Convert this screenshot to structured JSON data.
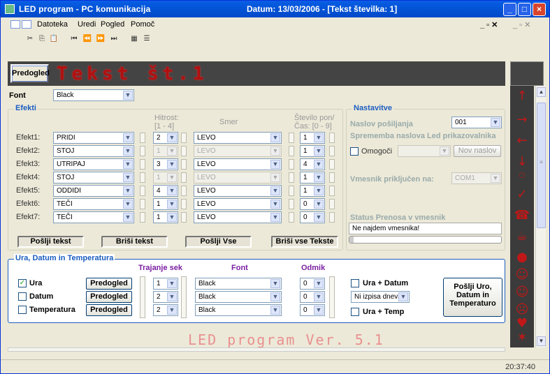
{
  "titlebar": {
    "title": "LED program - PC komunikacija",
    "date": "Datum: 13/03/2006 - [Tekst številka:  1]"
  },
  "menu": [
    "Datoteka",
    "Uredi",
    "Pogled",
    "Pomoč"
  ],
  "header": {
    "preview_button": "Predogled",
    "led_text": "Tekst št.1"
  },
  "font": {
    "label": "Font",
    "value": "Black"
  },
  "effects": {
    "legend": "Efekti",
    "speed_header": "Hitrost:",
    "speed_range": "[1 - 4]",
    "direction_header": "Smer",
    "repeat_header": "Število pon/",
    "repeat_range": "Čas:  [0 - 9]",
    "rows": [
      {
        "label": "Efekt1:",
        "effect": "PRIDI",
        "speed": "2",
        "direction": "LEVO",
        "repeat": "1",
        "enabled": true
      },
      {
        "label": "Efekt2:",
        "effect": "STOJ",
        "speed": "1",
        "direction": "LEVO",
        "repeat": "1",
        "enabled": false
      },
      {
        "label": "Efekt3:",
        "effect": "UTRIPAJ",
        "speed": "3",
        "direction": "LEVO",
        "repeat": "4",
        "enabled": false
      },
      {
        "label": "Efekt4:",
        "effect": "STOJ",
        "speed": "1",
        "direction": "LEVO",
        "repeat": "1",
        "enabled": false
      },
      {
        "label": "Efekt5:",
        "effect": "ODDIDI",
        "speed": "4",
        "direction": "LEVO",
        "repeat": "1",
        "enabled": true
      },
      {
        "label": "Efekt6:",
        "effect": "TEČI",
        "speed": "1",
        "direction": "LEVO",
        "repeat": "0",
        "enabled": true
      },
      {
        "label": "Efekt7:",
        "effect": "TEČI",
        "speed": "1",
        "direction": "LEVO",
        "repeat": "0",
        "enabled": true
      }
    ]
  },
  "buttons": {
    "send_text": "Pošlji tekst",
    "delete_text": "Briši tekst",
    "send_all": "Pošlji Vse",
    "delete_all": "Briši vse Tekste"
  },
  "settings": {
    "legend": "Nastavitve",
    "address_label": "Naslov pošiljanja",
    "address_value": "001",
    "change_label": "Sprememba naslova Led prikazovalnika",
    "enable_label": "Omogoči",
    "new_address": "Nov naslov",
    "port_label": "Vmesnik priključen na:",
    "port_value": "COM1",
    "status_label": "Status Prenosa v vmesnik",
    "status_value": "Ne najdem vmesnika!"
  },
  "clock": {
    "legend": "Ura, Datum in Temperatura",
    "duration_header": "Trajanje sek",
    "font_header": "Font",
    "offset_header": "Odmik",
    "rows": [
      {
        "label": "Ura",
        "checked": true,
        "preview": "Predogled",
        "duration": "1",
        "font": "Black",
        "offset": "0"
      },
      {
        "label": "Datum",
        "checked": false,
        "preview": "Predogled",
        "duration": "2",
        "font": "Black",
        "offset": "0"
      },
      {
        "label": "Temperatura",
        "checked": false,
        "preview": "Predogled",
        "duration": "2",
        "font": "Black",
        "offset": "0"
      }
    ],
    "combo1_label": "Ura  +  Datum",
    "combo_select": "Ni izpisa dneva",
    "combo2_label": "Ura  +  Temp",
    "send_button_l1": "Pošlji Uro,",
    "send_button_l2": "Datum in",
    "send_button_l3": "Temperaturo"
  },
  "bottom": {
    "led_text": "LED program Ver. 5.1"
  },
  "status": {
    "time": "20:37:40"
  },
  "colors": {
    "titlebar": "#0355d8",
    "led": "#b01010",
    "legend": "#1b5dc0",
    "header_purple": "#7b1fa2"
  }
}
